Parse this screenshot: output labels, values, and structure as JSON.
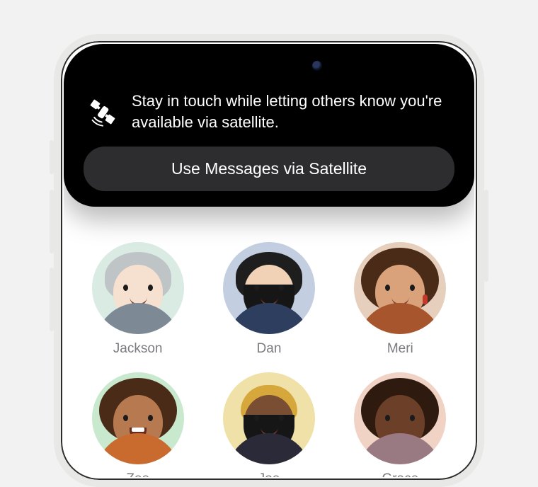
{
  "banner": {
    "message": "Stay in touch while letting others know you're available via satellite.",
    "button_label": "Use Messages via Satellite",
    "icon": "satellite-icon"
  },
  "contacts": [
    {
      "name": "Jackson",
      "bg": "bg-mint",
      "skin": "skin-fair",
      "hair": "hair-gray",
      "shirt": "shirt-gray",
      "curly": false,
      "beard": false,
      "beanie": false,
      "earrings": false,
      "open_mouth": false
    },
    {
      "name": "Dan",
      "bg": "bg-blue",
      "skin": "skin-light",
      "hair": "hair-black",
      "shirt": "shirt-blue",
      "curly": false,
      "beard": true,
      "beanie": false,
      "earrings": false,
      "open_mouth": false
    },
    {
      "name": "Meri",
      "bg": "bg-tan",
      "skin": "skin-tan",
      "hair": "hair-brown",
      "shirt": "shirt-rust",
      "curly": true,
      "beard": false,
      "beanie": false,
      "earrings": true,
      "open_mouth": false
    },
    {
      "name": "Zee",
      "bg": "bg-green",
      "skin": "skin-med",
      "hair": "hair-brown",
      "shirt": "shirt-orange",
      "curly": true,
      "beard": false,
      "beanie": false,
      "earrings": false,
      "open_mouth": true
    },
    {
      "name": "Joe",
      "bg": "bg-yellow",
      "skin": "skin-dark",
      "hair": "hair-darkbrown",
      "shirt": "shirt-navy",
      "curly": false,
      "beard": true,
      "beanie": true,
      "earrings": false,
      "open_mouth": false
    },
    {
      "name": "Grace",
      "bg": "bg-peach",
      "skin": "skin-deep",
      "hair": "hair-darkbrown",
      "shirt": "shirt-mauve",
      "curly": true,
      "beard": false,
      "beanie": false,
      "earrings": false,
      "open_mouth": false
    }
  ]
}
